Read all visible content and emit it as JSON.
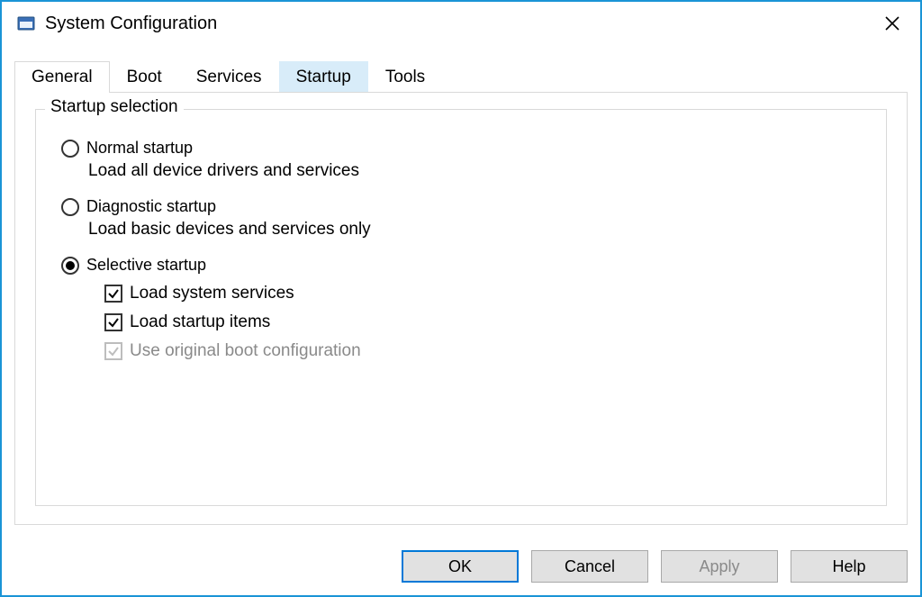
{
  "window": {
    "title": "System Configuration"
  },
  "tabs": {
    "general": "General",
    "boot": "Boot",
    "services": "Services",
    "startup": "Startup",
    "tools": "Tools"
  },
  "group": {
    "legend": "Startup selection",
    "normal": {
      "label": "Normal startup",
      "desc": "Load all device drivers and services",
      "selected": false
    },
    "diagnostic": {
      "label": "Diagnostic startup",
      "desc": "Load basic devices and services only",
      "selected": false
    },
    "selective": {
      "label": "Selective startup",
      "selected": true
    },
    "checks": {
      "load_services": {
        "label": "Load system services",
        "checked": true,
        "enabled": true
      },
      "load_startup": {
        "label": "Load startup items",
        "checked": true,
        "enabled": true
      },
      "use_original": {
        "label": "Use original boot configuration",
        "checked": true,
        "enabled": false
      }
    }
  },
  "buttons": {
    "ok": "OK",
    "cancel": "Cancel",
    "apply": "Apply",
    "help": "Help"
  }
}
